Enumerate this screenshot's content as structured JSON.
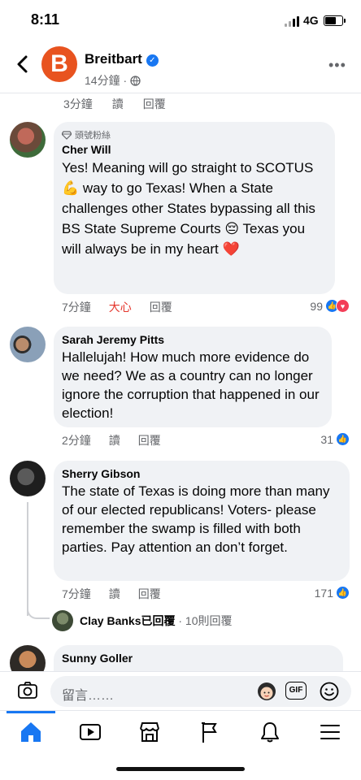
{
  "status": {
    "time": "8:11",
    "network": "4G"
  },
  "header": {
    "page_name": "Breitbart",
    "logo_letter": "B",
    "post_time": "14分鐘 · "
  },
  "partial_row": {
    "time": "3分鐘",
    "read": "讀",
    "reply": "回覆"
  },
  "comments": [
    {
      "badge": "頭號粉絲",
      "name": "Cher Will",
      "text_1": "Yes! Meaning will go straight to SCOTUS ",
      "text_2": " way to go Texas! When a State challenges other States bypassing all this BS State Supreme Courts ",
      "text_3": " Texas you will always be in my heart ",
      "emoji_1": "💪",
      "emoji_2": "😔",
      "emoji_3": "❤️",
      "time": "7分鐘",
      "reaction_label": "大心",
      "reply": "回覆",
      "count": "99"
    },
    {
      "name": "Sarah Jeremy Pitts",
      "text": "Hallelujah! How much more evidence do we need? We as a country can no longer ignore the corruption that happened in our election!",
      "time": "2分鐘",
      "read": "讀",
      "reply": "回覆",
      "count": "31"
    },
    {
      "name": "Sherry Gibson",
      "text": "The state of Texas is doing more than many of our elected republicans! Voters- please remember the swamp is filled with both parties. Pay attention an don’t forget.",
      "time": "7分鐘",
      "read": "讀",
      "reply": "回覆",
      "count": "171"
    },
    {
      "name": "Sunny Goller"
    }
  ],
  "reply_summary": {
    "name": "Clay Banks",
    "suffix": "已回覆",
    "count": " · 10則回覆"
  },
  "composer": {
    "placeholder": "留言……",
    "gif": "GIF"
  },
  "colors": {
    "accent": "#1877f2",
    "brand": "#e8531f",
    "love": "#e4352b"
  }
}
